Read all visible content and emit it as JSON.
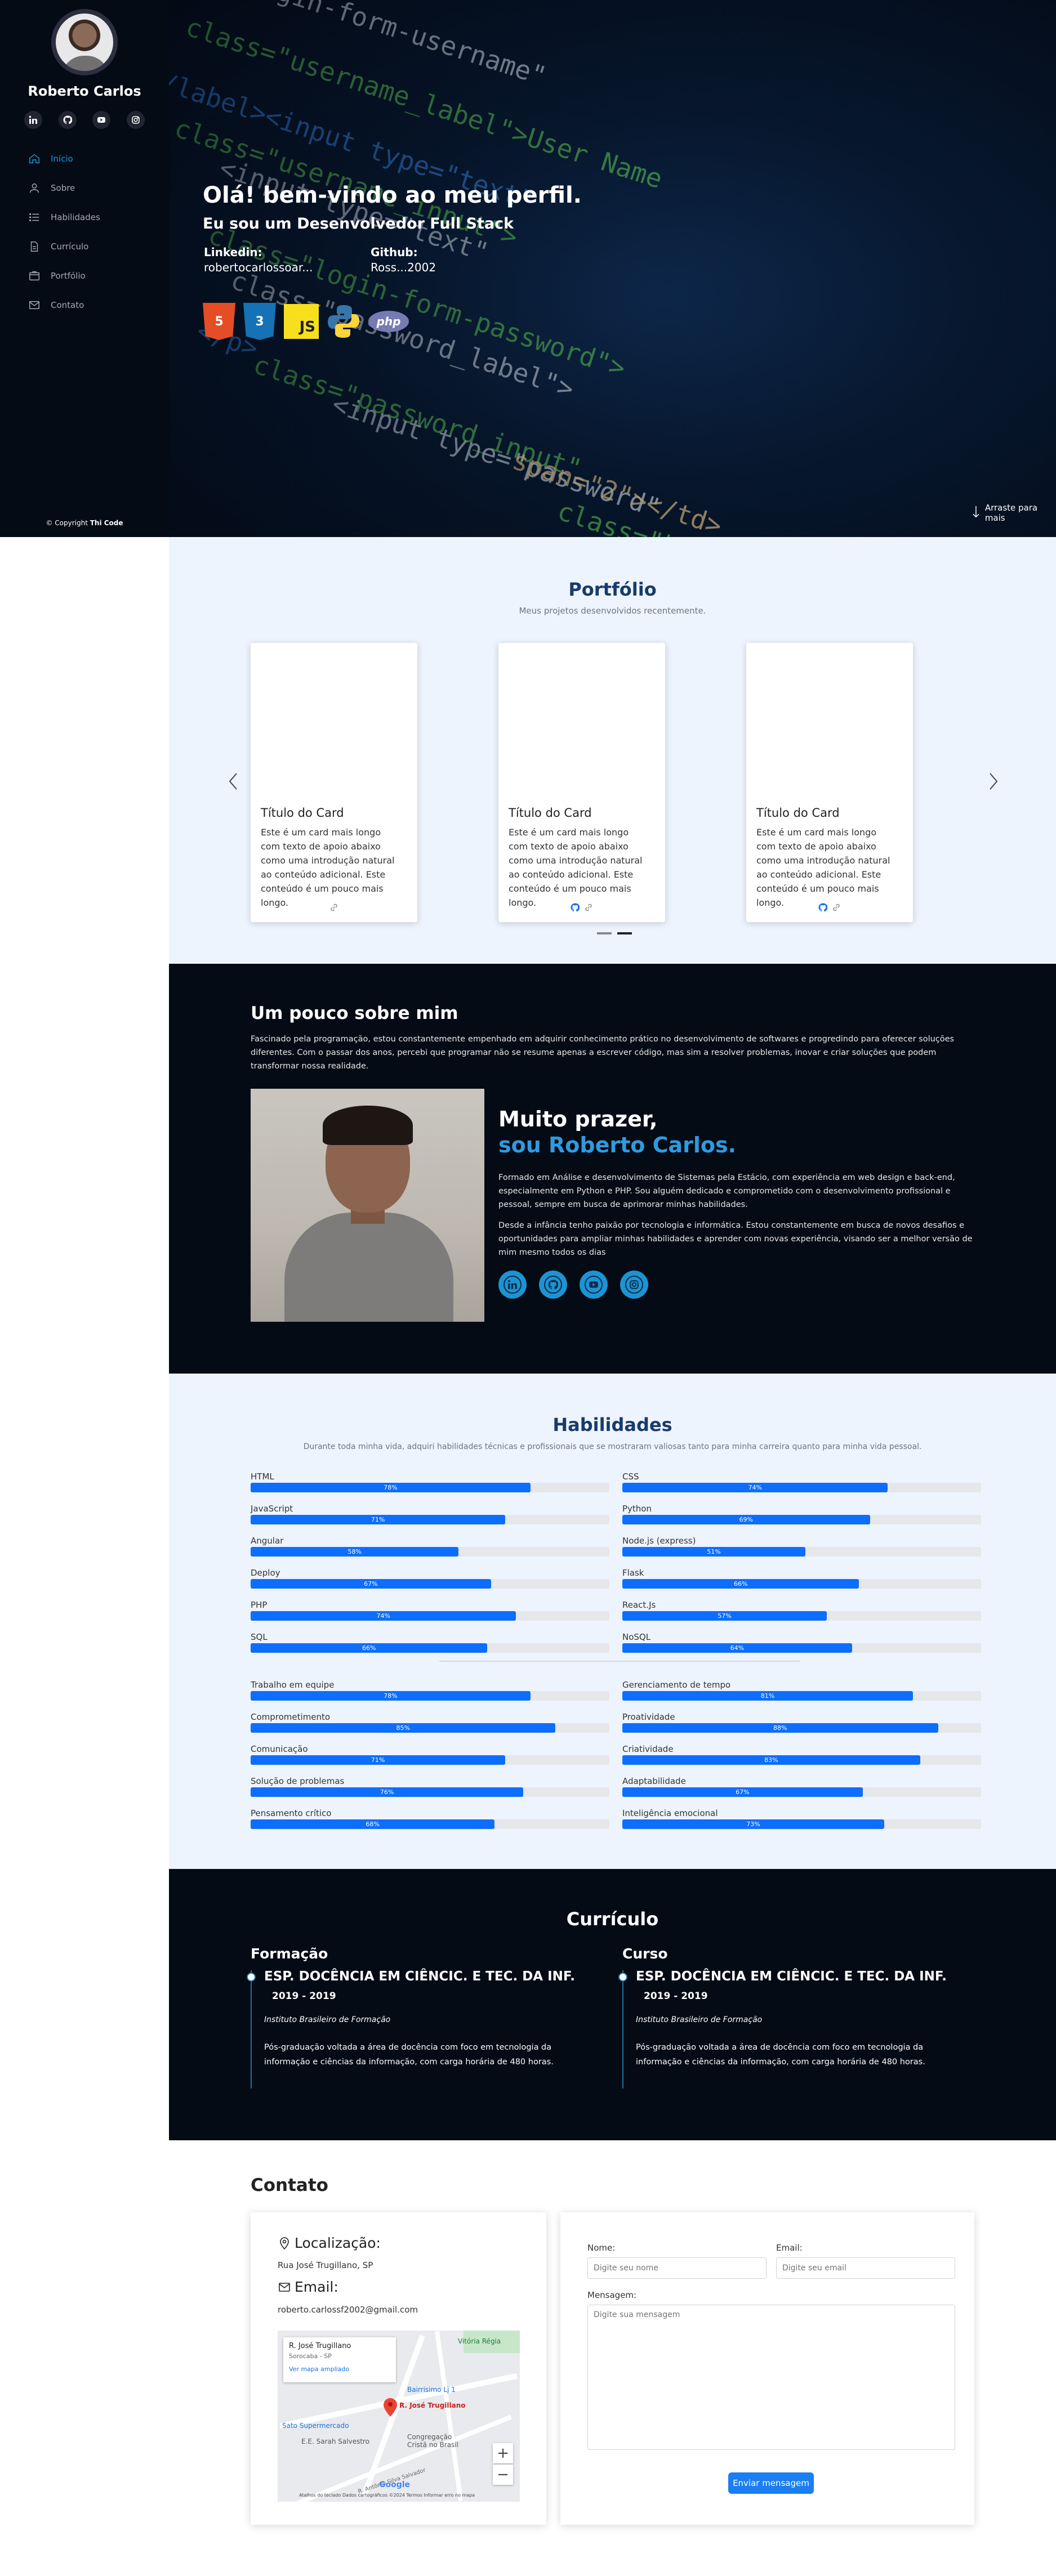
{
  "sidebar": {
    "name": "Roberto Carlos",
    "social": [
      "linkedin-icon",
      "github-icon",
      "youtube-icon",
      "instagram-icon"
    ],
    "nav": [
      {
        "label": "Início",
        "icon": "home-icon",
        "active": true
      },
      {
        "label": "Sobre",
        "icon": "user-icon"
      },
      {
        "label": "Habilidades",
        "icon": "list-icon"
      },
      {
        "label": "Currículo",
        "icon": "file-icon"
      },
      {
        "label": "Portfólio",
        "icon": "folder-icon"
      },
      {
        "label": "Contato",
        "icon": "envelope-icon"
      }
    ],
    "copyright_prefix": "© Copyright",
    "copyright_brand": "Thi Code"
  },
  "hero": {
    "title": "Olá! bem-vindo ao meu perfil.",
    "subtitle": "Eu sou um Desenvolvedor Full Stack",
    "linkedin_label": "Linkedin:",
    "linkedin_value": "robertocarlossoar...",
    "github_label": "Github:",
    "github_value": "Ross...2002",
    "tech_icons": [
      "html5-icon",
      "css3-icon",
      "javascript-icon",
      "python-icon",
      "php-icon"
    ],
    "scroll_hint": "Arraste para mais"
  },
  "portfolio": {
    "title": "Portfólio",
    "subtitle": "Meus projetos desenvolvidos recentemente.",
    "cards": [
      {
        "title": "Título do Card",
        "text": "Este é um card mais longo com texto de apoio abaixo como uma introdução natural ao conteúdo adicional. Este conteúdo é um pouco mais longo."
      },
      {
        "title": "Título do Card",
        "text": "Este é um card mais longo com texto de apoio abaixo como uma introdução natural ao conteúdo adicional. Este conteúdo é um pouco mais longo."
      },
      {
        "title": "Título do Card",
        "text": "Este é um card mais longo com texto de apoio abaixo como uma introdução natural ao conteúdo adicional. Este conteúdo é um pouco mais longo."
      }
    ]
  },
  "about": {
    "title": "Um pouco sobre mim",
    "intro": "Fascinado pela programação, estou constantemente empenhado em adquirir conhecimento prático no desenvolvimento de softwares e progredindo para oferecer soluções diferentes. Com o passar dos anos, percebi que programar não se resume apenas a escrever código, mas sim a resolver problemas, inovar e criar soluções que podem transformar nossa realidade.",
    "hello": "Muito prazer,",
    "name": "sou Roberto Carlos.",
    "p1": "Formado em Análise e desenvolvimento de Sistemas pela Estácio, com experiência em web design e back-end, especialmente em Python e PHP. Sou alguém dedicado e comprometido com o desenvolvimento profissional e pessoal, sempre em busca de aprimorar minhas habilidades.",
    "p2": "Desde a infância tenho paixão por tecnologia e informática. Estou constantemente em busca de novos desafios e oportunidades para ampliar minhas habilidades e aprender com novas experiência, visando ser a melhor versão de mim mesmo todos os dias"
  },
  "skills": {
    "title": "Habilidades",
    "subtitle": "Durante toda minha vida, adquiri habilidades técnicas e profissionais que se mostraram valiosas tanto para minha carreira quanto para minha vida pessoal.",
    "technical": [
      {
        "name": "HTML",
        "value": 78
      },
      {
        "name": "CSS",
        "value": 74
      },
      {
        "name": "JavaScript",
        "value": 71
      },
      {
        "name": "Python",
        "value": 69
      },
      {
        "name": "Angular",
        "value": 58
      },
      {
        "name": "Node.js (express)",
        "value": 51
      },
      {
        "name": "Deploy",
        "value": 67
      },
      {
        "name": "Flask",
        "value": 66
      },
      {
        "name": "PHP",
        "value": 74
      },
      {
        "name": "React.Js",
        "value": 57
      },
      {
        "name": "SQL",
        "value": 66
      },
      {
        "name": "NoSQL",
        "value": 64
      }
    ],
    "soft": [
      {
        "name": "Trabalho em equipe",
        "value": 78
      },
      {
        "name": "Gerenciamento de tempo",
        "value": 81
      },
      {
        "name": "Comprometimento",
        "value": 85
      },
      {
        "name": "Proatividade",
        "value": 88
      },
      {
        "name": "Comunicação",
        "value": 71
      },
      {
        "name": "Criatividade",
        "value": 83
      },
      {
        "name": "Solução de problemas",
        "value": 76
      },
      {
        "name": "Adaptabilidade",
        "value": 67
      },
      {
        "name": "Pensamento crítico",
        "value": 68
      },
      {
        "name": "Inteligência emocional",
        "value": 73
      }
    ]
  },
  "resume": {
    "title": "Currículo",
    "columns": [
      {
        "heading": "Formação",
        "item_title": "ESP. DOCÊNCIA EM CIÊNCIC. E TEC. DA INF.",
        "date": "2019 - 2019",
        "institution": "Instituto Brasileiro de Formação",
        "desc": "Pós-graduação voltada a área de docência com foco em tecnologia da informação e ciências da informação, com carga horária de 480 horas."
      },
      {
        "heading": "Curso",
        "item_title": "ESP. DOCÊNCIA EM CIÊNCIC. E TEC. DA INF.",
        "date": "2019 - 2019",
        "institution": "Instituto Brasileiro de Formação",
        "desc": "Pós-graduação voltada a área de docência com foco em tecnologia da informação e ciências da informação, com carga horária de 480 horas."
      }
    ]
  },
  "contact": {
    "title": "Contato",
    "location_label": "Localização:",
    "location_value": "Rua José Trugillano, SP",
    "email_label": "Email:",
    "email_value": "roberto.carlossf2002@gmail.com",
    "map": {
      "card_title": "R. José Trugillano",
      "card_sub": "Sorocaba - SP",
      "card_link": "Ver mapa ampliado",
      "pin_label": "R. José Trugillano",
      "place1": "Vitória Régia",
      "place2": "Bairrisimo Lj 1",
      "place3": "Sato Supermercado",
      "place4": "E.E. Sarah Salvestro",
      "place5": "Congregação Cristã no Brasil",
      "street": "R. Antônio Silva Salvador",
      "google": "Google",
      "footer": "Atalhos do teclado   Dados cartográficos ©2024   Termos   Informar erro no mapa"
    },
    "form": {
      "name_label": "Nome:",
      "name_placeholder": "Digite seu nome",
      "email_label": "Email:",
      "email_placeholder": "Digite seu email",
      "message_label": "Mensagem:",
      "message_placeholder": "Digite sua mensagem",
      "submit": "Enviar mensagem"
    }
  }
}
